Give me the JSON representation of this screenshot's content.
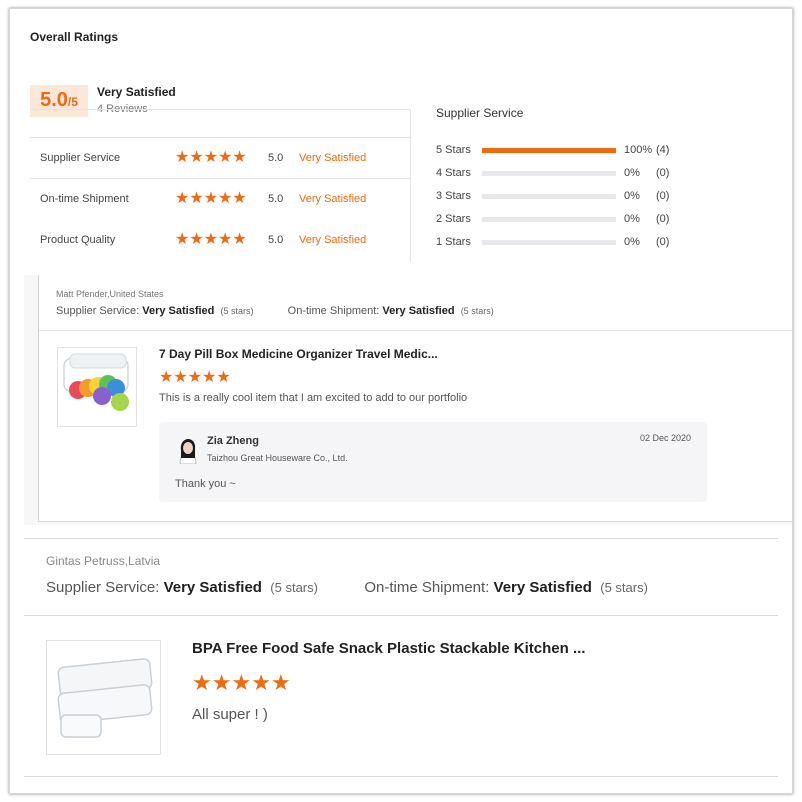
{
  "overall": {
    "title": "Overall Ratings",
    "score": "5.0",
    "score_suffix": "/5",
    "satisfaction": "Very Satisfied",
    "reviews": "4 Reviews",
    "accent_color": "#f06a0f",
    "categories": [
      {
        "label": "Supplier Service",
        "stars": 5,
        "score": "5.0",
        "text": "Very Satisfied"
      },
      {
        "label": "On-time Shipment",
        "stars": 5,
        "score": "5.0",
        "text": "Very Satisfied"
      },
      {
        "label": "Product Quality",
        "stars": 5,
        "score": "5.0",
        "text": "Very Satisfied"
      }
    ]
  },
  "breakdown": {
    "title": "Supplier Service",
    "rows": [
      {
        "label": "5 Stars",
        "percent": "100%",
        "count": "(4)",
        "fill": 1.0
      },
      {
        "label": "4 Stars",
        "percent": "0%",
        "count": "(0)",
        "fill": 0
      },
      {
        "label": "3 Stars",
        "percent": "0%",
        "count": "(0)",
        "fill": 0
      },
      {
        "label": "2 Stars",
        "percent": "0%",
        "count": "(0)",
        "fill": 0
      },
      {
        "label": "1 Stars",
        "percent": "0%",
        "count": "(0)",
        "fill": 0
      }
    ]
  },
  "reviews": [
    {
      "author": "Matt Pfender,United States",
      "supplier_label": "Supplier Service:",
      "supplier_value": "Very Satisfied",
      "supplier_stars": "(5 stars)",
      "shipment_label": "On-time Shipment:",
      "shipment_value": "Very Satisfied",
      "shipment_stars": "(5 stars)",
      "product_title": "7 Day Pill Box Medicine Organizer Travel Medic...",
      "stars": 5,
      "comment": "This is a really cool item that I am excited to add to our portfolio",
      "reply": {
        "name": "Zia Zheng",
        "company": "Taizhou Great Houseware Co., Ltd.",
        "date": "02 Dec 2020",
        "text": "Thank you ~"
      }
    },
    {
      "author": "Gintas Petruss,Latvia",
      "supplier_label": "Supplier Service:",
      "supplier_value": "Very Satisfied",
      "supplier_stars": "(5 stars)",
      "shipment_label": "On-time Shipment:",
      "shipment_value": "Very Satisfied",
      "shipment_stars": "(5 stars)",
      "product_title": "BPA Free Food Safe Snack Plastic Stackable Kitchen ...",
      "stars": 5,
      "comment": "All super ! )"
    }
  ]
}
